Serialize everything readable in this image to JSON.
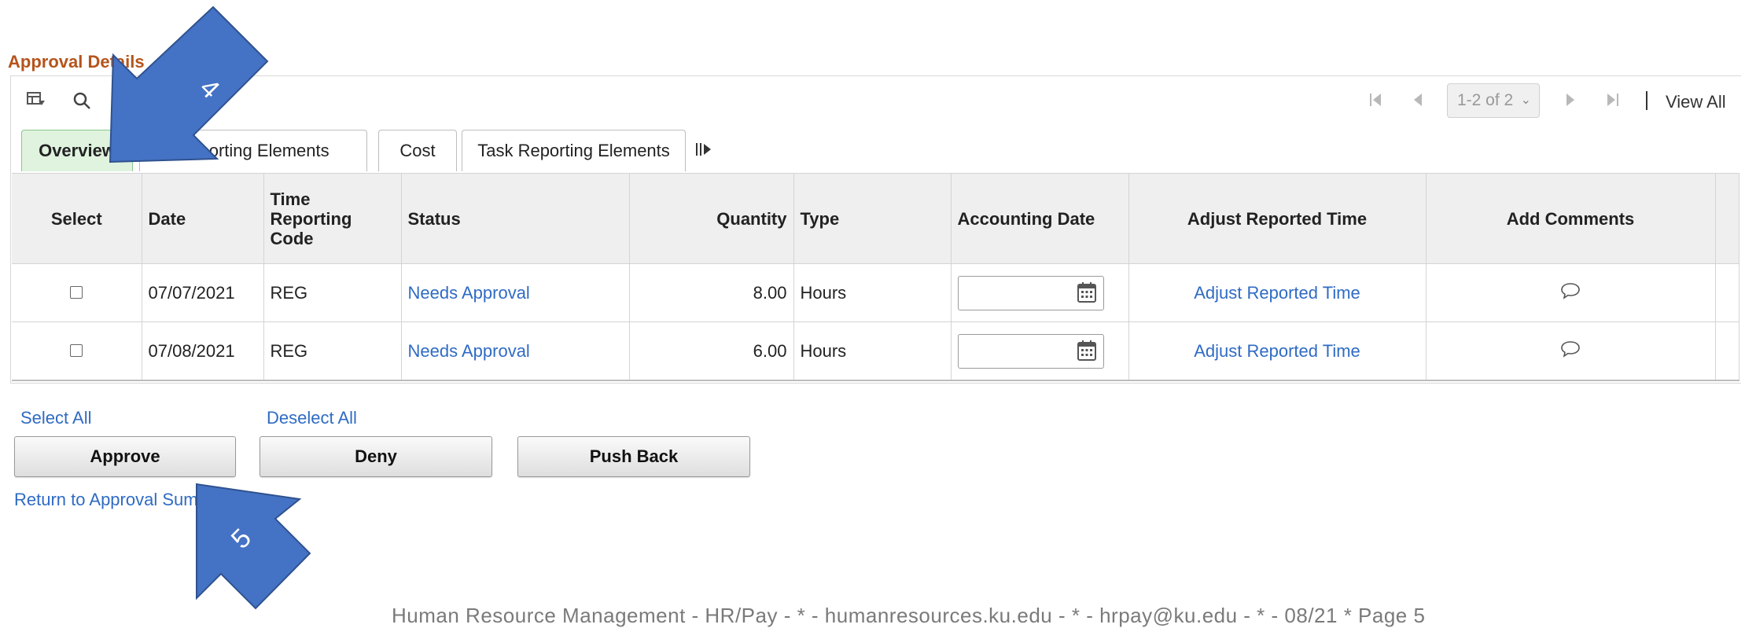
{
  "section": {
    "title": "Approval Details"
  },
  "toolbar": {
    "icons": [
      "grid-personalize-icon",
      "search-icon"
    ]
  },
  "pagination": {
    "range": "1-2 of 2",
    "view_all": "View All"
  },
  "tabs": [
    {
      "label": "Overview",
      "active": true
    },
    {
      "label": "Reporting Elements",
      "active": false
    },
    {
      "label": "Cost",
      "active": false
    },
    {
      "label": "Task Reporting Elements",
      "active": false
    }
  ],
  "table": {
    "headers": {
      "select": "Select",
      "date": "Date",
      "trc": "Time Reporting Code",
      "status": "Status",
      "quantity": "Quantity",
      "type": "Type",
      "accounting_date": "Accounting Date",
      "adjust": "Adjust Reported Time",
      "comments": "Add Comments"
    },
    "rows": [
      {
        "date": "07/07/2021",
        "trc": "REG",
        "status": "Needs Approval",
        "quantity": "8.00",
        "type": "Hours",
        "accounting_date": "",
        "adjust": "Adjust Reported Time"
      },
      {
        "date": "07/08/2021",
        "trc": "REG",
        "status": "Needs Approval",
        "quantity": "6.00",
        "type": "Hours",
        "accounting_date": "",
        "adjust": "Adjust Reported Time"
      }
    ]
  },
  "actions": {
    "select_all": "Select All",
    "deselect_all": "Deselect All",
    "approve": "Approve",
    "deny": "Deny",
    "push_back": "Push Back",
    "return_link": "Return to Approval Summ"
  },
  "annotations": {
    "arrow_4": "4",
    "arrow_5": "5",
    "arrow_color": "#4472c4"
  },
  "footer": {
    "text": "Human Resource Management  -  HR/Pay   -  *  -  humanresources.ku.edu  -  *  -  hrpay@ku.edu  -  *  -  08/21  * Page 5"
  },
  "colors": {
    "section_title": "#b5541c",
    "link": "#2f6bc4",
    "active_tab": "#dff3df"
  }
}
